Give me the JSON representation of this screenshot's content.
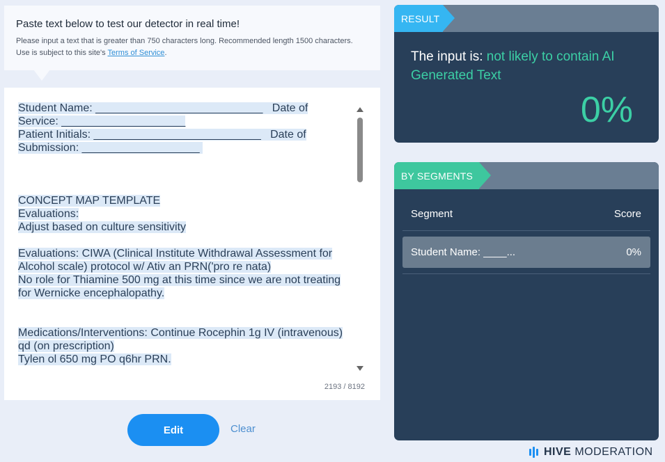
{
  "intro": {
    "title": "Paste text below to test our detector in real time!",
    "description": "Please input a text that is greater than 750 characters long. Recommended length 1500 characters. Use is subject to this site's ",
    "terms_link": "Terms of Service",
    "description_end": "."
  },
  "editor": {
    "text_lines": [
      "Student Name: ___________________________   Date of",
      "Service: ____________________",
      "Patient Initials: ___________________________   Date of",
      "Submission: ___________________ ",
      "",
      "",
      "",
      "CONCEPT MAP TEMPLATE",
      "Evaluations:",
      "Adjust based on culture sensitivity",
      "",
      "Evaluations: CIWA (Clinical Institute Withdrawal Assessment for",
      "Alcohol scale) protocol w/ Ativ an PRN('pro re nata)",
      "No role for Thiamine 500 mg at this time since we are not treating",
      "for Wernicke encephalopathy.",
      "",
      "",
      "Medications/Interventions: Continue Rocephin 1g IV (intravenous)",
      "qd (on prescription)",
      "Tylen ol 650 mg PO q6hr PRN."
    ],
    "char_count": "2193 / 8192"
  },
  "buttons": {
    "edit_label": "Edit",
    "clear_label": "Clear"
  },
  "result": {
    "tag": "RESULT",
    "verdict_prefix": "The input is: ",
    "verdict_highlight": "not likely to contain AI Generated Text",
    "percent": "0%"
  },
  "segments": {
    "tag": "BY SEGMENTS",
    "col_segment": "Segment",
    "col_score": "Score",
    "rows": [
      {
        "segment": "Student Name: ____...",
        "score": "0%"
      }
    ]
  },
  "brand": {
    "bold": "HIVE",
    "rest": "MODERATION"
  },
  "colors": {
    "accent_blue": "#1b8ff2",
    "result_tag": "#35b6f2",
    "segment_tag": "#3ec79e",
    "highlight_green": "#3ccfa5",
    "panel_bg": "#283f59"
  }
}
